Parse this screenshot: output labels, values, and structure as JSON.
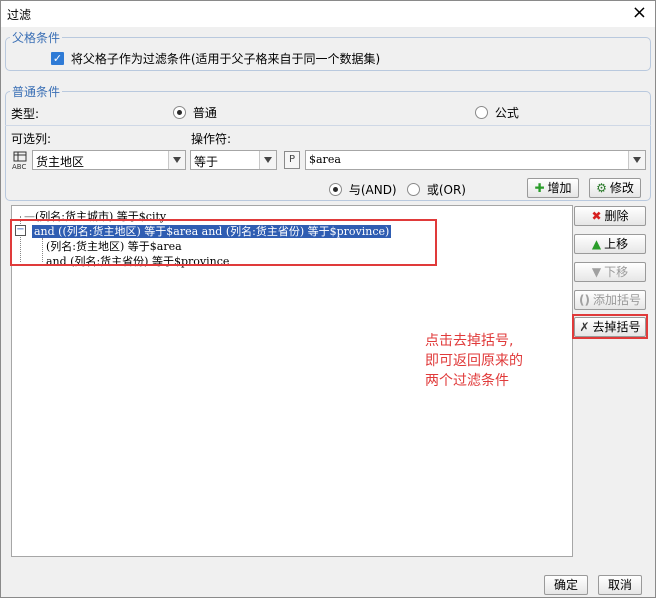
{
  "window": {
    "title": "过滤",
    "close_icon": "×"
  },
  "parent_group": {
    "legend": "父格条件",
    "checkbox_label": "将父格子作为过滤条件(适用于父子格来自于同一个数据集)",
    "checked": true
  },
  "normal_group": {
    "legend": "普通条件",
    "type_label": "类型:",
    "radio_normal": "普通",
    "radio_formula": "公式",
    "column_label": "可选列:",
    "operator_label": "操作符:",
    "column_value": "货主地区",
    "operator_value": "等于",
    "param_icon_text": "P",
    "param_value": "$area",
    "and_label": "与(AND)",
    "or_label": "或(OR)",
    "add_button": "增加",
    "modify_button": "修改"
  },
  "tree": {
    "line1": "(列名:货主城市) 等于$city",
    "line2": "and ((列名:货主地区) 等于$area and (列名:货主省份) 等于$province)",
    "line3": "(列名:货主地区) 等于$area",
    "line4": "and (列名:货主省份) 等于$province"
  },
  "side_buttons": {
    "delete": "删除",
    "move_up": "上移",
    "move_down": "下移",
    "add_bracket": "添加括号",
    "remove_bracket": "去掉括号"
  },
  "annotation": {
    "line1": "点击去掉括号,",
    "line2": "即可返回原来的",
    "line3": "两个过滤条件"
  },
  "footer": {
    "ok": "确定",
    "cancel": "取消"
  },
  "colors": {
    "accent": "#2f7bd6",
    "selection": "#2f5db2",
    "highlight": "#e03a3a",
    "legend": "#3a6fb5"
  }
}
